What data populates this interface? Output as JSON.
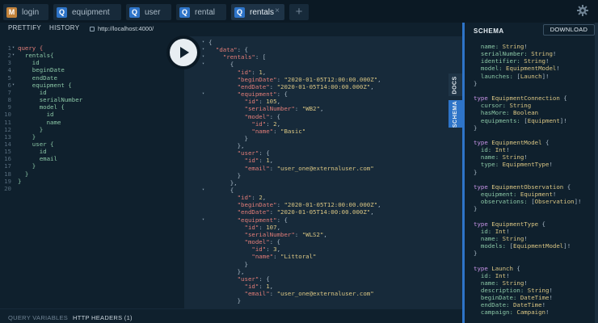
{
  "tabs": [
    {
      "badge": "M",
      "label": "login"
    },
    {
      "badge": "Q",
      "label": "equipment"
    },
    {
      "badge": "Q",
      "label": "user"
    },
    {
      "badge": "Q",
      "label": "rental"
    },
    {
      "badge": "Q",
      "label": "rentals",
      "close": "×"
    }
  ],
  "tab_add": "+",
  "toolbar": {
    "prettify": "PRETTIFY",
    "history": "HISTORY",
    "url": "http://localhost:4000/"
  },
  "editor_lines": [
    {
      "n": "1",
      "text": "query {",
      "fold": "▾",
      "kind": "kw"
    },
    {
      "n": "2",
      "text": "  rentals{",
      "fold": "▾"
    },
    {
      "n": "3",
      "text": "    id"
    },
    {
      "n": "4",
      "text": "    beginDate"
    },
    {
      "n": "5",
      "text": "    endDate"
    },
    {
      "n": "6",
      "text": "    equipment {",
      "fold": "▾"
    },
    {
      "n": "7",
      "text": "      id"
    },
    {
      "n": "8",
      "text": "      serialNumber"
    },
    {
      "n": "9",
      "text": "      model {"
    },
    {
      "n": "10",
      "text": "        id"
    },
    {
      "n": "11",
      "text": "        name"
    },
    {
      "n": "12",
      "text": "      }"
    },
    {
      "n": "13",
      "text": "    }"
    },
    {
      "n": "14",
      "text": "    user {"
    },
    {
      "n": "15",
      "text": "      id"
    },
    {
      "n": "16",
      "text": "      email"
    },
    {
      "n": "17",
      "text": "    }"
    },
    {
      "n": "18",
      "text": "  }"
    },
    {
      "n": "19",
      "text": "}"
    },
    {
      "n": "20",
      "text": ""
    }
  ],
  "result_lines": [
    {
      "fold": "▾",
      "t": [
        [
          "p",
          "{"
        ]
      ]
    },
    {
      "fold": "▾",
      "t": [
        [
          "p",
          "  "
        ],
        [
          "k",
          "\"data\""
        ],
        [
          "p",
          ": {"
        ]
      ]
    },
    {
      "fold": "▾",
      "t": [
        [
          "p",
          "    "
        ],
        [
          "k",
          "\"rentals\""
        ],
        [
          "p",
          ": ["
        ]
      ]
    },
    {
      "fold": "▾",
      "t": [
        [
          "p",
          "      {"
        ]
      ]
    },
    {
      "t": [
        [
          "p",
          "        "
        ],
        [
          "k",
          "\"id\""
        ],
        [
          "p",
          ": "
        ],
        [
          "n",
          "1"
        ],
        [
          "p",
          ","
        ]
      ]
    },
    {
      "t": [
        [
          "p",
          "        "
        ],
        [
          "k",
          "\"beginDate\""
        ],
        [
          "p",
          ": "
        ],
        [
          "s",
          "\"2020-01-05T12:00:00.000Z\""
        ],
        [
          "p",
          ","
        ]
      ]
    },
    {
      "t": [
        [
          "p",
          "        "
        ],
        [
          "k",
          "\"endDate\""
        ],
        [
          "p",
          ": "
        ],
        [
          "s",
          "\"2020-01-05T14:00:00.000Z\""
        ],
        [
          "p",
          ","
        ]
      ]
    },
    {
      "fold": "▾",
      "t": [
        [
          "p",
          "        "
        ],
        [
          "k",
          "\"equipment\""
        ],
        [
          "p",
          ": {"
        ]
      ]
    },
    {
      "t": [
        [
          "p",
          "          "
        ],
        [
          "k",
          "\"id\""
        ],
        [
          "p",
          ": "
        ],
        [
          "n",
          "105"
        ],
        [
          "p",
          ","
        ]
      ]
    },
    {
      "t": [
        [
          "p",
          "          "
        ],
        [
          "k",
          "\"serialNumber\""
        ],
        [
          "p",
          ": "
        ],
        [
          "s",
          "\"WB2\""
        ],
        [
          "p",
          ","
        ]
      ]
    },
    {
      "t": [
        [
          "p",
          "          "
        ],
        [
          "k",
          "\"model\""
        ],
        [
          "p",
          ": {"
        ]
      ]
    },
    {
      "t": [
        [
          "p",
          "            "
        ],
        [
          "k",
          "\"id\""
        ],
        [
          "p",
          ": "
        ],
        [
          "n",
          "2"
        ],
        [
          "p",
          ","
        ]
      ]
    },
    {
      "t": [
        [
          "p",
          "            "
        ],
        [
          "k",
          "\"name\""
        ],
        [
          "p",
          ": "
        ],
        [
          "s",
          "\"Basic\""
        ]
      ]
    },
    {
      "t": [
        [
          "p",
          "          }"
        ]
      ]
    },
    {
      "t": [
        [
          "p",
          "        },"
        ]
      ]
    },
    {
      "t": [
        [
          "p",
          "        "
        ],
        [
          "k",
          "\"user\""
        ],
        [
          "p",
          ": {"
        ]
      ]
    },
    {
      "t": [
        [
          "p",
          "          "
        ],
        [
          "k",
          "\"id\""
        ],
        [
          "p",
          ": "
        ],
        [
          "n",
          "1"
        ],
        [
          "p",
          ","
        ]
      ]
    },
    {
      "t": [
        [
          "p",
          "          "
        ],
        [
          "k",
          "\"email\""
        ],
        [
          "p",
          ": "
        ],
        [
          "s",
          "\"user_one@externaluser.com\""
        ]
      ]
    },
    {
      "t": [
        [
          "p",
          "        }"
        ]
      ]
    },
    {
      "t": [
        [
          "p",
          "      },"
        ]
      ]
    },
    {
      "fold": "▾",
      "t": [
        [
          "p",
          "      {"
        ]
      ]
    },
    {
      "t": [
        [
          "p",
          "        "
        ],
        [
          "k",
          "\"id\""
        ],
        [
          "p",
          ": "
        ],
        [
          "n",
          "2"
        ],
        [
          "p",
          ","
        ]
      ]
    },
    {
      "t": [
        [
          "p",
          "        "
        ],
        [
          "k",
          "\"beginDate\""
        ],
        [
          "p",
          ": "
        ],
        [
          "s",
          "\"2020-01-05T12:00:00.000Z\""
        ],
        [
          "p",
          ","
        ]
      ]
    },
    {
      "t": [
        [
          "p",
          "        "
        ],
        [
          "k",
          "\"endDate\""
        ],
        [
          "p",
          ": "
        ],
        [
          "s",
          "\"2020-01-05T14:00:00.000Z\""
        ],
        [
          "p",
          ","
        ]
      ]
    },
    {
      "fold": "▾",
      "t": [
        [
          "p",
          "        "
        ],
        [
          "k",
          "\"equipment\""
        ],
        [
          "p",
          ": {"
        ]
      ]
    },
    {
      "t": [
        [
          "p",
          "          "
        ],
        [
          "k",
          "\"id\""
        ],
        [
          "p",
          ": "
        ],
        [
          "n",
          "107"
        ],
        [
          "p",
          ","
        ]
      ]
    },
    {
      "t": [
        [
          "p",
          "          "
        ],
        [
          "k",
          "\"serialNumber\""
        ],
        [
          "p",
          ": "
        ],
        [
          "s",
          "\"WLS2\""
        ],
        [
          "p",
          ","
        ]
      ]
    },
    {
      "t": [
        [
          "p",
          "          "
        ],
        [
          "k",
          "\"model\""
        ],
        [
          "p",
          ": {"
        ]
      ]
    },
    {
      "t": [
        [
          "p",
          "            "
        ],
        [
          "k",
          "\"id\""
        ],
        [
          "p",
          ": "
        ],
        [
          "n",
          "3"
        ],
        [
          "p",
          ","
        ]
      ]
    },
    {
      "t": [
        [
          "p",
          "            "
        ],
        [
          "k",
          "\"name\""
        ],
        [
          "p",
          ": "
        ],
        [
          "s",
          "\"Littoral\""
        ]
      ]
    },
    {
      "t": [
        [
          "p",
          "          }"
        ]
      ]
    },
    {
      "t": [
        [
          "p",
          "        },"
        ]
      ]
    },
    {
      "t": [
        [
          "p",
          "        "
        ],
        [
          "k",
          "\"user\""
        ],
        [
          "p",
          ": {"
        ]
      ]
    },
    {
      "t": [
        [
          "p",
          "          "
        ],
        [
          "k",
          "\"id\""
        ],
        [
          "p",
          ": "
        ],
        [
          "n",
          "1"
        ],
        [
          "p",
          ","
        ]
      ]
    },
    {
      "t": [
        [
          "p",
          "          "
        ],
        [
          "k",
          "\"email\""
        ],
        [
          "p",
          ": "
        ],
        [
          "s",
          "\"user_one@externaluser.com\""
        ]
      ]
    },
    {
      "t": [
        [
          "p",
          "        }"
        ]
      ]
    }
  ],
  "side_tabs": {
    "docs": "DOCS",
    "schema": "SCHEMA"
  },
  "bottom": {
    "query_variables": "QUERY VARIABLES",
    "http_headers": "HTTP HEADERS (1)"
  },
  "schema_panel": {
    "title": "SCHEMA",
    "download": "DOWNLOAD",
    "lines": [
      [
        [
          "sfld",
          "  name: "
        ],
        [
          "stype",
          "String"
        ],
        [
          "sp",
          "!"
        ]
      ],
      [
        [
          "sfld",
          "  serialNumber: "
        ],
        [
          "stype",
          "String"
        ],
        [
          "sp",
          "!"
        ]
      ],
      [
        [
          "sfld",
          "  identifier: "
        ],
        [
          "stype",
          "String"
        ],
        [
          "sp",
          "!"
        ]
      ],
      [
        [
          "sfld",
          "  model: "
        ],
        [
          "stype",
          "EquipmentModel"
        ],
        [
          "sp",
          "!"
        ]
      ],
      [
        [
          "sfld",
          "  launches: "
        ],
        [
          "sp",
          "["
        ],
        [
          "stype",
          "Launch"
        ],
        [
          "sp",
          "]!"
        ]
      ],
      [
        [
          "sp",
          "}"
        ]
      ],
      [],
      [
        [
          "skw",
          "type "
        ],
        [
          "stype",
          "EquipmentConnection"
        ],
        [
          "sp",
          " {"
        ]
      ],
      [
        [
          "sfld",
          "  cursor: "
        ],
        [
          "stype",
          "String"
        ]
      ],
      [
        [
          "sfld",
          "  hasMore: "
        ],
        [
          "stype",
          "Boolean"
        ]
      ],
      [
        [
          "sfld",
          "  equipments: "
        ],
        [
          "sp",
          "["
        ],
        [
          "stype",
          "Equipment"
        ],
        [
          "sp",
          "]!"
        ]
      ],
      [
        [
          "sp",
          "}"
        ]
      ],
      [],
      [
        [
          "skw",
          "type "
        ],
        [
          "stype",
          "EquipmentModel"
        ],
        [
          "sp",
          " {"
        ]
      ],
      [
        [
          "sfld",
          "  id: "
        ],
        [
          "stype",
          "Int"
        ],
        [
          "sp",
          "!"
        ]
      ],
      [
        [
          "sfld",
          "  name: "
        ],
        [
          "stype",
          "String"
        ],
        [
          "sp",
          "!"
        ]
      ],
      [
        [
          "sfld",
          "  type: "
        ],
        [
          "stype",
          "EquipmentType"
        ],
        [
          "sp",
          "!"
        ]
      ],
      [
        [
          "sp",
          "}"
        ]
      ],
      [],
      [
        [
          "skw",
          "type "
        ],
        [
          "stype",
          "EquipmentObservation"
        ],
        [
          "sp",
          " {"
        ]
      ],
      [
        [
          "sfld",
          "  equipment: "
        ],
        [
          "stype",
          "Equipment"
        ],
        [
          "sp",
          "!"
        ]
      ],
      [
        [
          "sfld",
          "  observations: "
        ],
        [
          "sp",
          "["
        ],
        [
          "stype",
          "Observation"
        ],
        [
          "sp",
          "]!"
        ]
      ],
      [
        [
          "sp",
          "}"
        ]
      ],
      [],
      [
        [
          "skw",
          "type "
        ],
        [
          "stype",
          "EquipmentType"
        ],
        [
          "sp",
          " {"
        ]
      ],
      [
        [
          "sfld",
          "  id: "
        ],
        [
          "stype",
          "Int"
        ],
        [
          "sp",
          "!"
        ]
      ],
      [
        [
          "sfld",
          "  name: "
        ],
        [
          "stype",
          "String"
        ],
        [
          "sp",
          "!"
        ]
      ],
      [
        [
          "sfld",
          "  models: "
        ],
        [
          "sp",
          "["
        ],
        [
          "stype",
          "EquipmentModel"
        ],
        [
          "sp",
          "]!"
        ]
      ],
      [
        [
          "sp",
          "}"
        ]
      ],
      [],
      [
        [
          "skw",
          "type "
        ],
        [
          "stype",
          "Launch"
        ],
        [
          "sp",
          " {"
        ]
      ],
      [
        [
          "sfld",
          "  id: "
        ],
        [
          "stype",
          "Int"
        ],
        [
          "sp",
          "!"
        ]
      ],
      [
        [
          "sfld",
          "  name: "
        ],
        [
          "stype",
          "String"
        ],
        [
          "sp",
          "!"
        ]
      ],
      [
        [
          "sfld",
          "  description: "
        ],
        [
          "stype",
          "String"
        ],
        [
          "sp",
          "!"
        ]
      ],
      [
        [
          "sfld",
          "  beginDate: "
        ],
        [
          "stype",
          "DateTime"
        ],
        [
          "sp",
          "!"
        ]
      ],
      [
        [
          "sfld",
          "  endDate: "
        ],
        [
          "stype",
          "DateTime"
        ],
        [
          "sp",
          "!"
        ]
      ],
      [
        [
          "sfld",
          "  campaign: "
        ],
        [
          "stype",
          "Campaign"
        ],
        [
          "sp",
          "!"
        ]
      ]
    ]
  }
}
